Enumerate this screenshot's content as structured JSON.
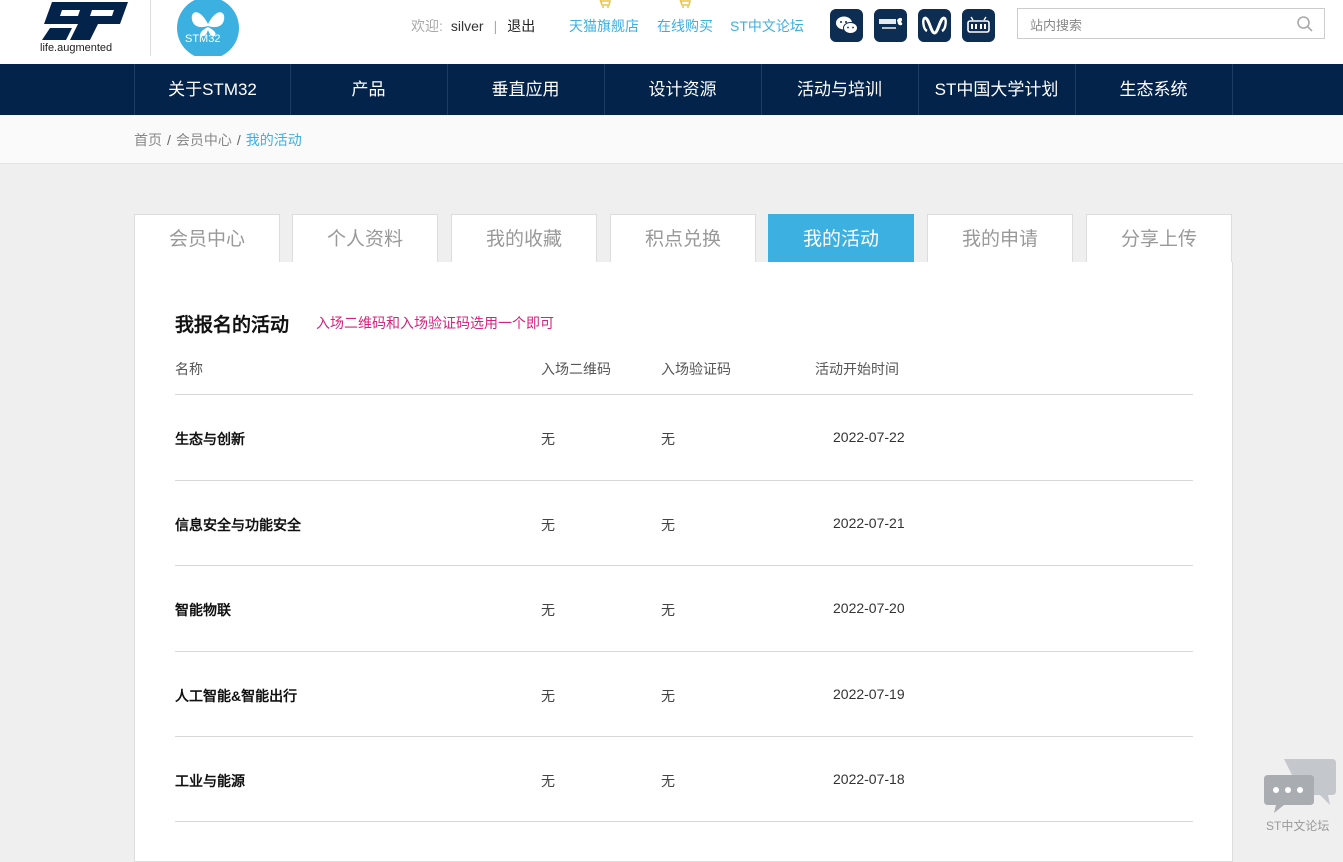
{
  "brand": {
    "st_tagline": "life.augmented",
    "stm_label": "STM32"
  },
  "user": {
    "welcome_label": "欢迎:",
    "username": "silver",
    "separator": "|",
    "logout_label": "退出"
  },
  "top_links": [
    {
      "label": "天猫旗舰店"
    },
    {
      "label": "在线购买"
    },
    {
      "label": "ST中文论坛"
    }
  ],
  "social_icons": [
    "wechat-icon",
    "stm32-finder-icon",
    "weibo-icon",
    "bilibili-icon"
  ],
  "search": {
    "placeholder": "站内搜索",
    "value": ""
  },
  "nav": {
    "items": [
      {
        "label": "关于STM32"
      },
      {
        "label": "产品"
      },
      {
        "label": "垂直应用"
      },
      {
        "label": "设计资源"
      },
      {
        "label": "活动与培训"
      },
      {
        "label": "ST中国大学计划"
      },
      {
        "label": "生态系统"
      }
    ]
  },
  "breadcrumb": {
    "items": [
      "首页",
      "会员中心",
      "我的活动"
    ],
    "separator": "/"
  },
  "tabs": [
    {
      "label": "会员中心",
      "active": false
    },
    {
      "label": "个人资料",
      "active": false
    },
    {
      "label": "我的收藏",
      "active": false
    },
    {
      "label": "积点兑换",
      "active": false
    },
    {
      "label": "我的活动",
      "active": true
    },
    {
      "label": "我的申请",
      "active": false
    },
    {
      "label": "分享上传",
      "active": false
    }
  ],
  "activities": {
    "title": "我报名的活动",
    "note": "入场二维码和入场验证码选用一个即可",
    "columns": [
      "名称",
      "入场二维码",
      "入场验证码",
      "活动开始时间"
    ],
    "rows": [
      {
        "name": "生态与创新",
        "qr": "无",
        "code": "无",
        "date": "2022-07-22"
      },
      {
        "name": "信息安全与功能安全",
        "qr": "无",
        "code": "无",
        "date": "2022-07-21"
      },
      {
        "name": "智能物联",
        "qr": "无",
        "code": "无",
        "date": "2022-07-20"
      },
      {
        "name": "人工智能&智能出行",
        "qr": "无",
        "code": "无",
        "date": "2022-07-19"
      },
      {
        "name": "工业与能源",
        "qr": "无",
        "code": "无",
        "date": "2022-07-18"
      }
    ]
  },
  "floating": {
    "forum_label": "ST中文论坛"
  },
  "colors": {
    "nav_bg": "#03234b",
    "accent": "#3db0e2",
    "note": "#d4237a",
    "page_bg": "#efefef"
  }
}
